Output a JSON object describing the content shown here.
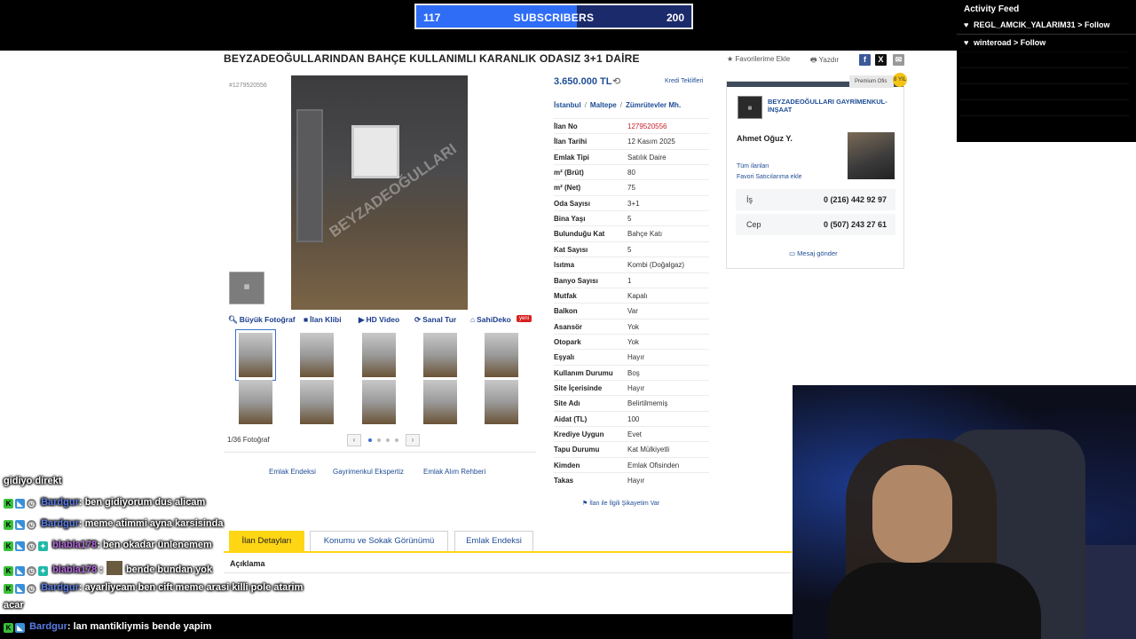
{
  "overlay": {
    "subscribers": {
      "current": "117",
      "label": "SUBSCRIBERS",
      "goal": "200",
      "progress": 0.585
    },
    "activity_feed": {
      "title": "Activity Feed",
      "items": [
        {
          "text": "REGL_AMCIK_YALARIM31 > Follow"
        },
        {
          "text": "winteroad > Follow"
        }
      ]
    }
  },
  "listing": {
    "title": "BEYZADEOĞULLARINDAN BAHÇE KULLANIMLI KARANLIK ODASIZ 3+1 DAİRE",
    "favorite_link": "Favorilerime Ekle",
    "print_link": "Yazdır",
    "small_id": "#1279520556",
    "watermark": "BEYZADEOĞULLARI",
    "media_buttons": [
      "Büyük Fotoğraf",
      "İlan Klibi",
      "HD Video",
      "Sanal Tur",
      "SahiDeko"
    ],
    "new_badge": "yeni",
    "photo_count": "1/36 Fotoğraf",
    "price": "3.650.000 TL",
    "credit_link": "Kredi Teklifleri",
    "breadcrumb": [
      "İstanbul",
      "Maltepe",
      "Zümrütevler Mh."
    ],
    "specs": [
      {
        "k": "İlan No",
        "v": "1279520556"
      },
      {
        "k": "İlan Tarihi",
        "v": "12 Kasım 2025"
      },
      {
        "k": "Emlak Tipi",
        "v": "Satılık Daire"
      },
      {
        "k": "m² (Brüt)",
        "v": "80"
      },
      {
        "k": "m² (Net)",
        "v": "75"
      },
      {
        "k": "Oda Sayısı",
        "v": "3+1"
      },
      {
        "k": "Bina Yaşı",
        "v": "5"
      },
      {
        "k": "Bulunduğu Kat",
        "v": "Bahçe Katı"
      },
      {
        "k": "Kat Sayısı",
        "v": "5"
      },
      {
        "k": "Isıtma",
        "v": "Kombi (Doğalgaz)"
      },
      {
        "k": "Banyo Sayısı",
        "v": "1"
      },
      {
        "k": "Mutfak",
        "v": "Kapalı"
      },
      {
        "k": "Balkon",
        "v": "Var"
      },
      {
        "k": "Asansör",
        "v": "Yok"
      },
      {
        "k": "Otopark",
        "v": "Yok"
      },
      {
        "k": "Eşyalı",
        "v": "Hayır"
      },
      {
        "k": "Kullanım Durumu",
        "v": "Boş"
      },
      {
        "k": "Site İçerisinde",
        "v": "Hayır"
      },
      {
        "k": "Site Adı",
        "v": "Belirtilmemiş"
      },
      {
        "k": "Aidat (TL)",
        "v": "100"
      },
      {
        "k": "Krediye Uygun",
        "v": "Evet"
      },
      {
        "k": "Tapu Durumu",
        "v": "Kat Mülkiyetli"
      },
      {
        "k": "Kimden",
        "v": "Emlak Ofisinden"
      },
      {
        "k": "Takas",
        "v": "Hayır"
      }
    ],
    "report_link": "İlan ile İlgili Şikayetim Var",
    "bottom_links": [
      "Emlak Endeksi",
      "Gayrimenkul Ekspertiz",
      "Emlak Alım Rehberi"
    ],
    "tabs": [
      "İlan Detayları",
      "Konumu ve Sokak Görünümü",
      "Emlak Endeksi"
    ],
    "description_heading": "Açıklama"
  },
  "seller": {
    "premium_label": "Premium Ofis",
    "premium_badge": "8 YIL",
    "company": "BEYZADEOĞULLARI GAYRİMENKUL-İNŞAAT",
    "person": "Ahmet Oğuz Y.",
    "links": [
      "Tüm ilanları",
      "Favori Satıcılarıma ekle"
    ],
    "phones": [
      {
        "k": "İş",
        "v": "0 (216) 442 92 97"
      },
      {
        "k": "Cep",
        "v": "0 (507) 243 27 61"
      }
    ],
    "message_link": "Mesaj gönder"
  },
  "chat": [
    {
      "user": "",
      "text": "gidiyo direkt"
    },
    {
      "user": "Bardgur",
      "text": ": ben gidiyorum dus alicam"
    },
    {
      "user": "Bardgur",
      "text": ": meme atimmi ayna karsisinda"
    },
    {
      "user": "blabla178",
      "text": ": ben okadar ünlenemem"
    },
    {
      "user": "blabla178",
      "text": "bende bundan yok"
    },
    {
      "user": "Bardgur",
      "text": ": ayarliycam ben cift meme arasi killi pole atarim"
    },
    {
      "user": "",
      "text": "acar"
    },
    {
      "user": "Bardgur",
      "text": ": lan mantikliymis bende yapim"
    }
  ]
}
